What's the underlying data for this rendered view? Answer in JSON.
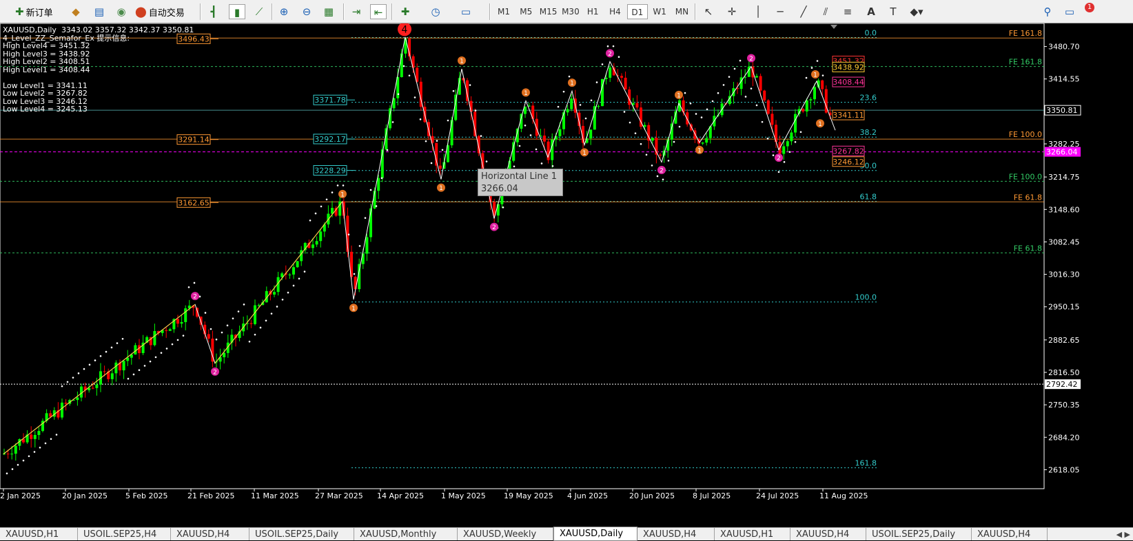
{
  "toolbar": {
    "new_order": "新订单",
    "auto_trading": "自动交易",
    "timeframes": [
      "M1",
      "M5",
      "M15",
      "M30",
      "H1",
      "H4",
      "D1",
      "W1",
      "MN"
    ],
    "active_timeframe": "D1",
    "notification_count": "1"
  },
  "info": {
    "symbol_line": "XAUUSD,Daily  3343.02 3357.32 3342.37 3350.81",
    "indicator_title": "4_Level_ZZ_Semafor_Ex 提示信息:",
    "levels": [
      "High Level4 = 3451.32",
      "High Level3 = 3438.92",
      "High Level2 = 3408.51",
      "High Level1 = 3408.44",
      "",
      "Low Level1 = 3341.11",
      "Low Level2 = 3267.82",
      "Low Level3 = 3246.12",
      "Low Level4 = 3245.13"
    ]
  },
  "tooltip": {
    "name": "Horizontal Line 1",
    "value": "3266.04"
  },
  "chart_data": {
    "type": "candlestick",
    "symbol": "XAUUSD",
    "timeframe": "Daily",
    "ylim": [
      2585,
      3525
    ],
    "y_ticks": [
      3480.7,
      3414.55,
      3348.4,
      3282.25,
      3214.75,
      3148.6,
      3082.45,
      3016.3,
      2950.15,
      2882.65,
      2816.5,
      2750.35,
      2684.2,
      2618.05
    ],
    "current_price": "3350.81",
    "current_price_value": 3350.81,
    "hline_label": "3266.04",
    "hline_value": 3266.04,
    "dotted_level_label": "2792.42",
    "dotted_level_value": 2792.42,
    "x_labels": [
      "2 Jan 2025",
      "20 Jan 2025",
      "5 Feb 2025",
      "21 Feb 2025",
      "11 Mar 2025",
      "27 Mar 2025",
      "14 Apr 2025",
      "1 May 2025",
      "19 May 2025",
      "4 Jun 2025",
      "20 Jun 2025",
      "8 Jul 2025",
      "24 Jul 2025",
      "11 Aug 2025"
    ],
    "left_tags": [
      {
        "label": "3496.43",
        "value": 3496.43,
        "color": "#ff9933"
      },
      {
        "label": "3371.78",
        "value": 3371.78,
        "color": "#33cccc"
      },
      {
        "label": "3291.14",
        "value": 3291.14,
        "color": "#ff9933"
      },
      {
        "label": "3292.17",
        "value": 3292.17,
        "color": "#33cccc"
      },
      {
        "label": "3228.29",
        "value": 3228.29,
        "color": "#33cccc"
      },
      {
        "label": "3162.65",
        "value": 3162.65,
        "color": "#ff9933"
      }
    ],
    "right_tags": [
      {
        "label": "3451.32",
        "value": 3451.32,
        "color": "#ff3333"
      },
      {
        "label": "3438.92",
        "value": 3438.92,
        "color": "#ffcc33"
      },
      {
        "label": "3408.44",
        "value": 3408.44,
        "color": "#ff3399"
      },
      {
        "label": "3341.11",
        "value": 3341.11,
        "color": "#ff9933"
      },
      {
        "label": "3267.82",
        "value": 3267.82,
        "color": "#ff3399"
      },
      {
        "label": "3246.12",
        "value": 3246.12,
        "color": "#ff9933"
      }
    ],
    "fib_levels": [
      {
        "label": "0.0",
        "value": 3499.0
      },
      {
        "label": "23.6",
        "value": 3367.0
      },
      {
        "label": "38.2",
        "value": 3296.0
      },
      {
        "label": "50.0",
        "value": 3228.0
      },
      {
        "label": "61.8",
        "value": 3165.0
      },
      {
        "label": "100.0",
        "value": 2960.0
      },
      {
        "label": "161.8",
        "value": 2622.0
      }
    ],
    "fe_levels": [
      {
        "label": "FE 161.8",
        "value": 3498.0,
        "color": "#ff9933"
      },
      {
        "label": "FE 161.8",
        "value": 3440.0,
        "color": "#33cc66"
      },
      {
        "label": "FE 100.0",
        "value": 3292.0,
        "color": "#ff9933"
      },
      {
        "label": "FE 100.0",
        "value": 3206.0,
        "color": "#33cc66"
      },
      {
        "label": "FE 61.8",
        "value": 3164.0,
        "color": "#ff9933"
      },
      {
        "label": "FE 61.8",
        "value": 3060.0,
        "color": "#33cc66"
      }
    ],
    "zigzag": [
      [
        5,
        2650
      ],
      [
        283,
        2955
      ],
      [
        312,
        2835
      ],
      [
        497,
        3165
      ],
      [
        513,
        2965
      ],
      [
        588,
        3500
      ],
      [
        640,
        3210
      ],
      [
        670,
        3435
      ],
      [
        717,
        3130
      ],
      [
        763,
        3370
      ],
      [
        795,
        3255
      ],
      [
        830,
        3390
      ],
      [
        848,
        3280
      ],
      [
        885,
        3450
      ],
      [
        960,
        3245
      ],
      [
        985,
        3365
      ],
      [
        1015,
        3285
      ],
      [
        1090,
        3440
      ],
      [
        1130,
        3270
      ],
      [
        1185,
        3410
      ],
      [
        1212,
        3310
      ]
    ],
    "semafor": [
      {
        "x": 587,
        "y": 3516,
        "n": "4",
        "size": "big"
      },
      {
        "x": 283,
        "y": 2972,
        "n": "2"
      },
      {
        "x": 312,
        "y": 2818,
        "n": "2"
      },
      {
        "x": 497,
        "y": 3180,
        "n": "1"
      },
      {
        "x": 513,
        "y": 2948,
        "n": "1"
      },
      {
        "x": 640,
        "y": 3193,
        "n": "1"
      },
      {
        "x": 670,
        "y": 3452,
        "n": "1"
      },
      {
        "x": 717,
        "y": 3113,
        "n": "2"
      },
      {
        "x": 763,
        "y": 3387,
        "n": "1"
      },
      {
        "x": 830,
        "y": 3407,
        "n": "1"
      },
      {
        "x": 848,
        "y": 3265,
        "n": "1"
      },
      {
        "x": 885,
        "y": 3467,
        "n": "2"
      },
      {
        "x": 960,
        "y": 3229,
        "n": "2"
      },
      {
        "x": 985,
        "y": 3382,
        "n": "1"
      },
      {
        "x": 1015,
        "y": 3270,
        "n": "1"
      },
      {
        "x": 1090,
        "y": 3457,
        "n": "2"
      },
      {
        "x": 1130,
        "y": 3254,
        "n": "2"
      },
      {
        "x": 1183,
        "y": 3424,
        "n": "1"
      },
      {
        "x": 1190,
        "y": 3324,
        "n": "1"
      }
    ]
  },
  "tabs": [
    "XAUUSD,H1",
    "USOIL.SEP25,H4",
    "XAUUSD,H4",
    "USOIL.SEP25,Daily",
    "XAUUSD,Monthly",
    "XAUUSD,Weekly",
    "XAUUSD,Daily",
    "XAUUSD,H4",
    "XAUUSD,H1",
    "XAUUSD,H4",
    "USOIL.SEP25,Daily",
    "XAUUSD,H4"
  ],
  "active_tab": 6,
  "colors": {
    "bull": "#00ff00",
    "bear": "#ff0000",
    "zigzag": "#ffffff",
    "grid_green": "#33cc66",
    "grid_orange": "#ff9933",
    "magenta": "#ff00ff"
  }
}
